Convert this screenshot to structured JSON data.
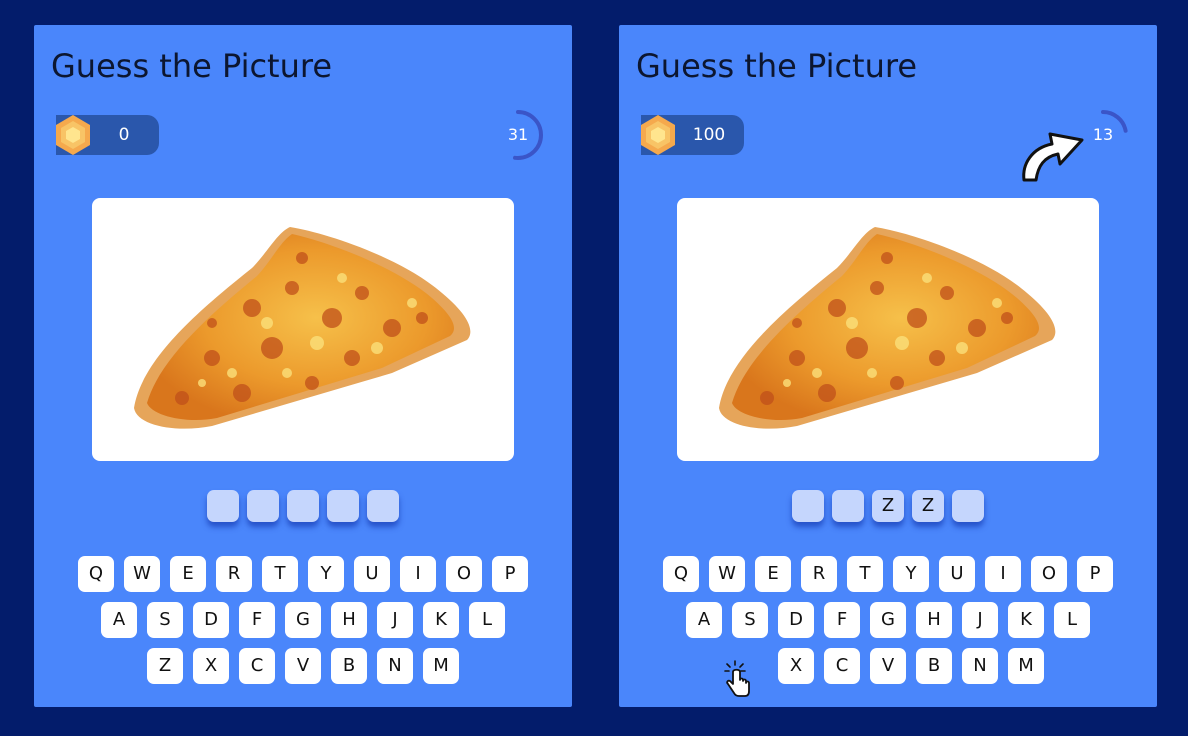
{
  "colors": {
    "page_bg": "#031c6b",
    "panel_bg": "#4a86fb",
    "score_pill": "#2a57ac",
    "slot": "#c5d6fd",
    "key": "#ffffff",
    "timer_ring": "#3a55c8",
    "gem": "#f5a94d"
  },
  "left": {
    "title": "Guess the Picture",
    "score": "0",
    "timer": "31",
    "timer_fraction": 0.52,
    "picture_icon": "pizza-slice-image",
    "slots": [
      "",
      "",
      "",
      "",
      ""
    ],
    "rows": [
      [
        "Q",
        "W",
        "E",
        "R",
        "T",
        "Y",
        "U",
        "I",
        "O",
        "P"
      ],
      [
        "A",
        "S",
        "D",
        "F",
        "G",
        "H",
        "J",
        "K",
        "L"
      ],
      [
        "Z",
        "X",
        "C",
        "V",
        "B",
        "N",
        "M"
      ]
    ]
  },
  "right": {
    "title": "Guess the Picture",
    "score": "100",
    "timer": "13",
    "timer_fraction": 0.22,
    "picture_icon": "pizza-slice-image",
    "slots": [
      "",
      "",
      "Z",
      "Z",
      ""
    ],
    "rows": [
      [
        "Q",
        "W",
        "E",
        "R",
        "T",
        "Y",
        "U",
        "I",
        "O",
        "P"
      ],
      [
        "A",
        "S",
        "D",
        "F",
        "G",
        "H",
        "J",
        "K",
        "L"
      ],
      [
        "",
        "X",
        "C",
        "V",
        "B",
        "N",
        "M"
      ]
    ]
  },
  "overlay_icons": [
    "curved-arrow-icon",
    "hand-cursor-icon"
  ]
}
